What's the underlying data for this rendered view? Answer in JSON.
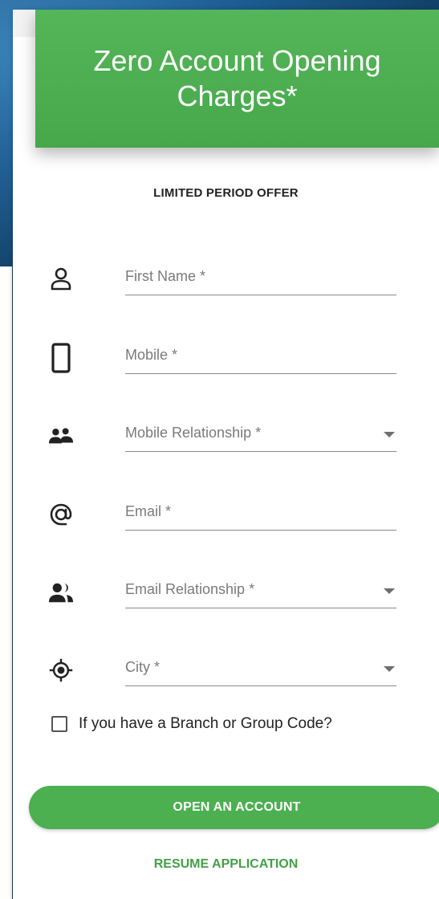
{
  "banner": {
    "title": "Zero Account Opening Charges*"
  },
  "offer_text": "LIMITED PERIOD OFFER",
  "fields": {
    "first_name": {
      "placeholder": "First Name *",
      "icon": "person-outline-icon"
    },
    "mobile": {
      "placeholder": "Mobile *",
      "icon": "phone-icon"
    },
    "mobile_relationship": {
      "placeholder": "Mobile Relationship *",
      "icon": "people-icon"
    },
    "email": {
      "placeholder": "Email *",
      "icon": "at-sign-icon"
    },
    "email_relationship": {
      "placeholder": "Email Relationship *",
      "icon": "people-filled-icon"
    },
    "city": {
      "placeholder": "City *",
      "icon": "location-target-icon"
    }
  },
  "branch_code_checkbox": {
    "label": "If you have a Branch or Group Code?"
  },
  "buttons": {
    "open_account": "OPEN AN ACCOUNT",
    "resume_application": "RESUME APPLICATION"
  },
  "colors": {
    "accent": "#4caf50",
    "link": "#43a047",
    "background_blue": "#1d5f96"
  }
}
